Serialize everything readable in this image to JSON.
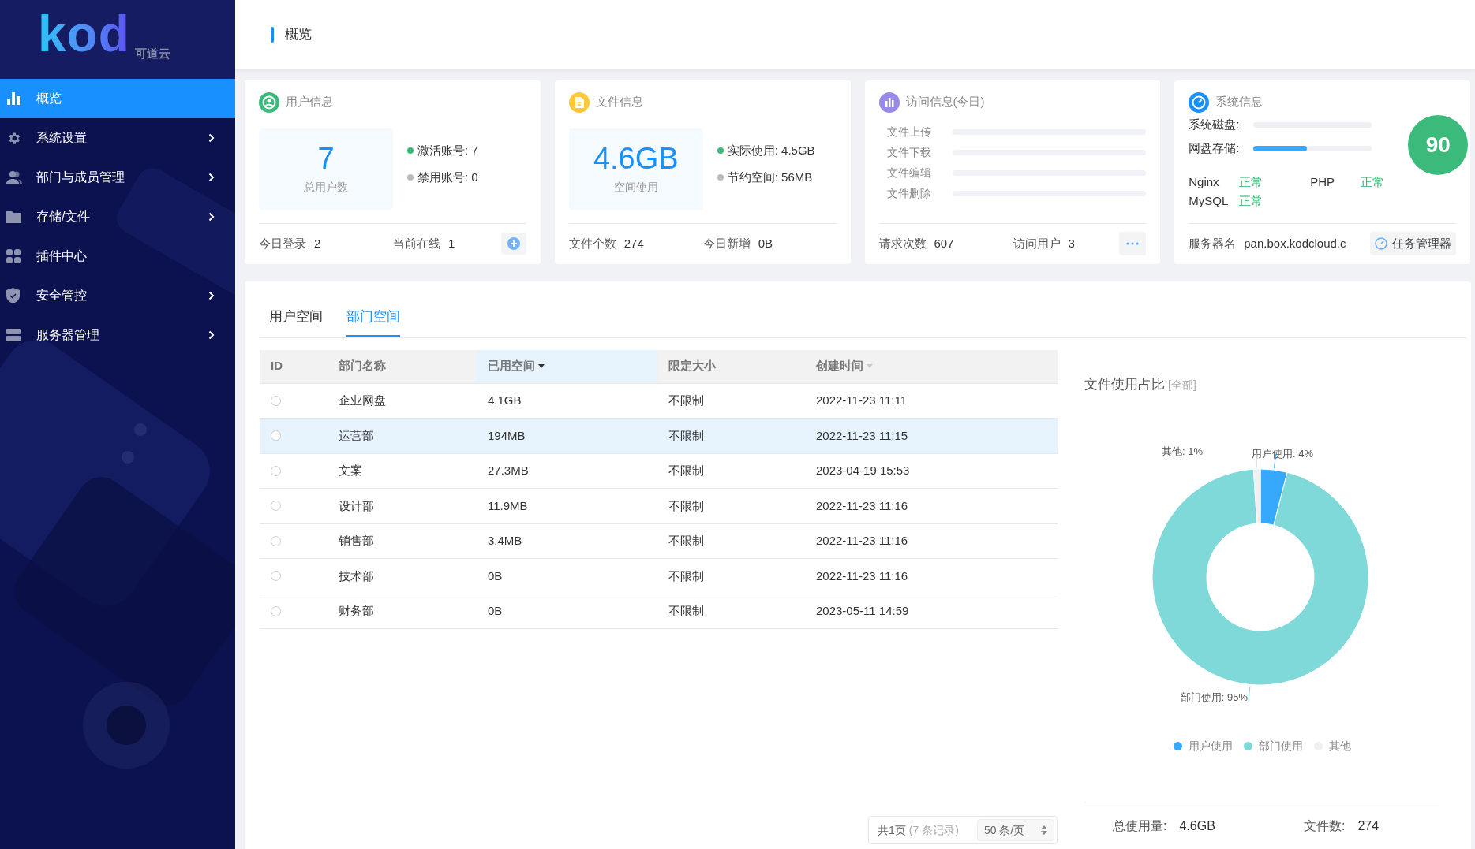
{
  "sidebar": {
    "logo": {
      "wordmark": "kod",
      "tagline": "可道云"
    },
    "items": [
      {
        "label": "概览",
        "selected": true,
        "expandable": false
      },
      {
        "label": "系统设置",
        "selected": false,
        "expandable": true
      },
      {
        "label": "部门与成员管理",
        "selected": false,
        "expandable": true
      },
      {
        "label": "存储/文件",
        "selected": false,
        "expandable": true
      },
      {
        "label": "插件中心",
        "selected": false,
        "expandable": false
      },
      {
        "label": "安全管控",
        "selected": false,
        "expandable": true
      },
      {
        "label": "服务器管理",
        "selected": false,
        "expandable": true
      }
    ]
  },
  "header": {
    "title": "概览"
  },
  "cards": [
    {
      "kind": "user",
      "title": "用户信息",
      "big_value": "7",
      "big_label": "总用户数",
      "stats": [
        {
          "label": "激活账号: 7",
          "color": "#3cba7c"
        },
        {
          "label": "禁用账号: 0",
          "color": "#bbbbbb"
        }
      ],
      "footer": [
        {
          "label": "今日登录",
          "value": "2"
        },
        {
          "label": "当前在线",
          "value": "1"
        }
      ]
    },
    {
      "kind": "file",
      "title": "文件信息",
      "big_value": "4.6GB",
      "big_label": "空间使用",
      "stats": [
        {
          "label": "实际使用: 4.5GB",
          "color": "#3cba7c"
        },
        {
          "label": "节约空间: 56MB",
          "color": "#bbbbbb"
        }
      ],
      "footer": [
        {
          "label": "文件个数",
          "value": "274"
        },
        {
          "label": "今日新增",
          "value": "0B"
        }
      ]
    },
    {
      "kind": "access",
      "title": "访问信息(今日)",
      "bars": [
        {
          "label": "文件上传",
          "level": 0
        },
        {
          "label": "文件下载",
          "level": 0
        },
        {
          "label": "文件编辑",
          "level": 0
        },
        {
          "label": "文件删除",
          "level": 0
        }
      ],
      "footer": [
        {
          "label": "请求次数",
          "value": "607"
        },
        {
          "label": "访问用户",
          "value": "3"
        }
      ]
    },
    {
      "kind": "system",
      "title": "系统信息",
      "bars": [
        {
          "label": "系统磁盘:",
          "level": 0
        },
        {
          "label": "网盘存储:",
          "level": 0.45
        }
      ],
      "score": "90",
      "services": [
        {
          "name": "Nginx",
          "status": "正常",
          "ok": true
        },
        {
          "name": "PHP",
          "status": "正常",
          "ok": true
        },
        {
          "name": "MySQL",
          "status": "正常",
          "ok": true
        }
      ],
      "server": {
        "label": "服务器名",
        "value": "pan.box.kodcloud.c"
      },
      "button": "任务管理器"
    }
  ],
  "tabs": [
    {
      "label": "用户空间",
      "selected": false
    },
    {
      "label": "部门空间",
      "selected": true
    }
  ],
  "table": {
    "columns": [
      {
        "label": "ID",
        "sortable": false,
        "sorted": false
      },
      {
        "label": "部门名称",
        "sortable": false,
        "sorted": false
      },
      {
        "label": "已用空间",
        "sortable": true,
        "sorted": true
      },
      {
        "label": "限定大小",
        "sortable": false,
        "sorted": false
      },
      {
        "label": "创建时间",
        "sortable": true,
        "sorted": false
      }
    ],
    "rows": [
      {
        "checked": false,
        "selected": false,
        "name": "企业网盘",
        "used": "4.1GB",
        "limit": "不限制",
        "created": "2022-11-23 11:11"
      },
      {
        "checked": false,
        "selected": true,
        "name": "运营部",
        "used": "194MB",
        "limit": "不限制",
        "created": "2022-11-23 11:15"
      },
      {
        "checked": false,
        "selected": false,
        "name": "文案",
        "used": "27.3MB",
        "limit": "不限制",
        "created": "2023-04-19 15:53"
      },
      {
        "checked": false,
        "selected": false,
        "name": "设计部",
        "used": "11.9MB",
        "limit": "不限制",
        "created": "2022-11-23 11:16"
      },
      {
        "checked": false,
        "selected": false,
        "name": "销售部",
        "used": "3.4MB",
        "limit": "不限制",
        "created": "2022-11-23 11:16"
      },
      {
        "checked": false,
        "selected": false,
        "name": "技术部",
        "used": "0B",
        "limit": "不限制",
        "created": "2022-11-23 11:16"
      },
      {
        "checked": false,
        "selected": false,
        "name": "财务部",
        "used": "0B",
        "limit": "不限制",
        "created": "2023-05-11 14:59"
      }
    ]
  },
  "pagination": {
    "pages": "共1页",
    "records": "(7 条记录)",
    "page_size": "50 条/页"
  },
  "usage": {
    "title": "文件使用占比",
    "filter": "[全部]",
    "chart_data": {
      "type": "donut",
      "categories": [
        "用户使用",
        "部门使用",
        "其他"
      ],
      "series": [
        {
          "values": [
            4,
            95,
            1
          ]
        }
      ],
      "colors": [
        "#36a9fc",
        "#80d9d9",
        "#eef0f4"
      ],
      "value_labels": [
        "用户使用: 4%",
        "部门使用: 95%",
        "其他: 1%"
      ]
    },
    "totals": [
      {
        "label": "总使用量:",
        "value": "4.6GB"
      },
      {
        "label": "文件数:",
        "value": "274"
      }
    ]
  }
}
